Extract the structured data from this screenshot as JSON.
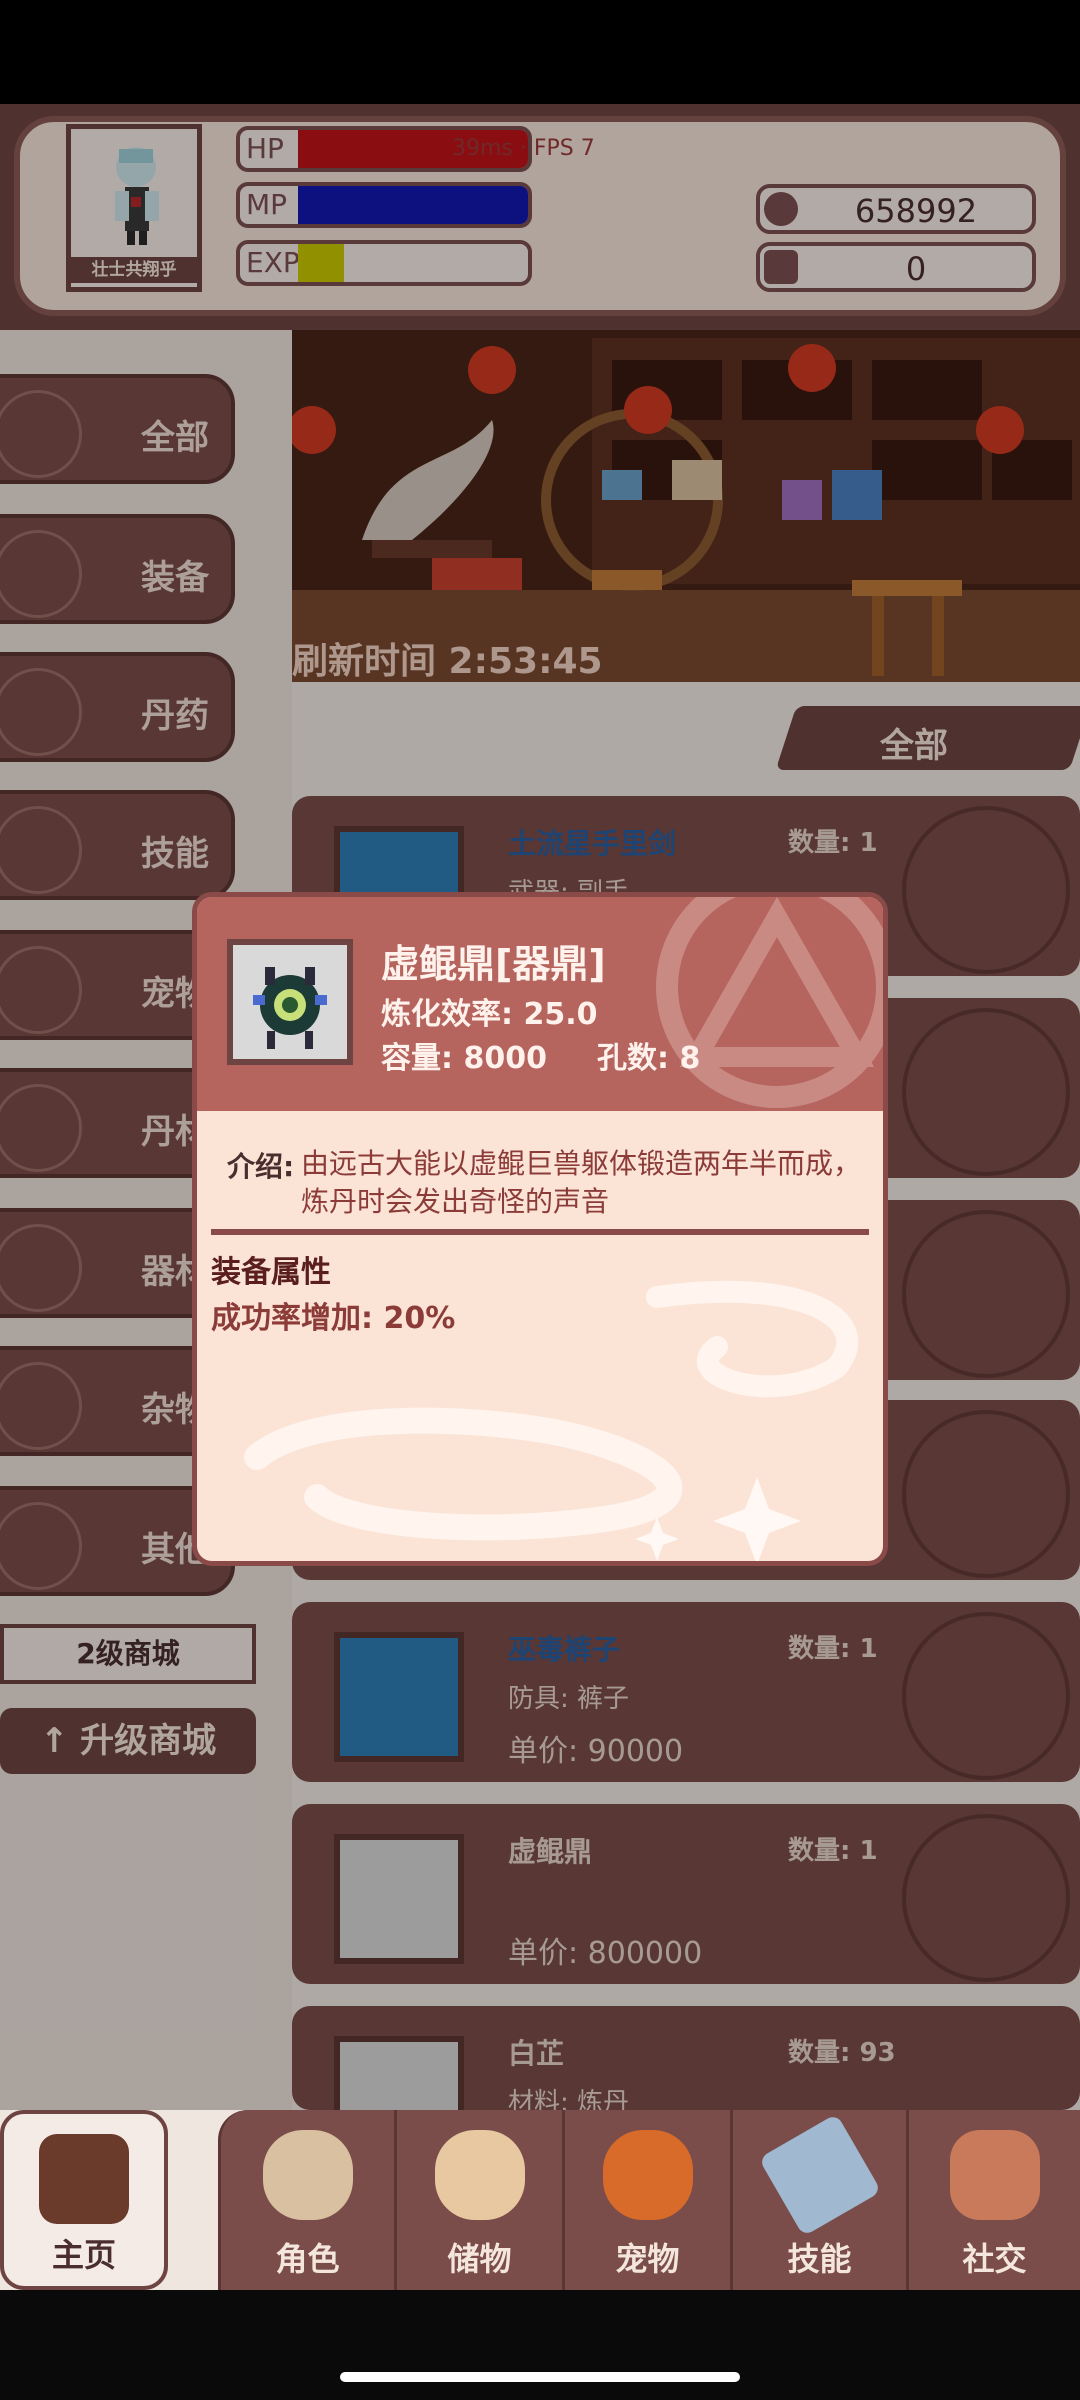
{
  "player": {
    "name": "壮士共翔乎",
    "hp_label": "HP",
    "mp_label": "MP",
    "exp_label": "EXP",
    "hp_fill": 1.0,
    "mp_fill": 1.0,
    "exp_fill": 0.2
  },
  "network": {
    "text": "39ms · FPS 7"
  },
  "currency": {
    "coins": "658992",
    "gems": "0"
  },
  "sidebar": {
    "items": [
      {
        "label": "全部"
      },
      {
        "label": "装备"
      },
      {
        "label": "丹药"
      },
      {
        "label": "技能"
      },
      {
        "label": "宠物"
      },
      {
        "label": "丹材"
      },
      {
        "label": "器材"
      },
      {
        "label": "杂物"
      },
      {
        "label": "其他"
      }
    ],
    "shop_level": "2级商城",
    "upgrade_label": "↑ 升级商城"
  },
  "shop": {
    "refresh_text": "刷新时间 2:53:45",
    "filter_label": "全部",
    "items": [
      {
        "name": "土流星手里剑",
        "qty": "数量: 1",
        "type": "武器: 副手",
        "price": ""
      },
      {
        "name": "巫毒裤子",
        "qty": "数量: 1",
        "type": "防具: 裤子",
        "price": "单价: 90000"
      },
      {
        "name": "虚鲲鼎",
        "qty": "数量: 1",
        "type": "",
        "price": "单价: 800000"
      },
      {
        "name": "白芷",
        "qty": "数量: 93",
        "type": "材料: 炼丹",
        "price": ""
      }
    ]
  },
  "dialog": {
    "title": "虚鲲鼎[器鼎]",
    "efficiency": "炼化效率: 25.0",
    "capacity": "容量: 8000",
    "holes": "孔数: 8",
    "intro_label": "介绍:",
    "intro_text": "由远古大能以虚鲲巨兽躯体锻造两年半而成，炼丹时会发出奇怪的声音",
    "attr_title": "装备属性",
    "attr_text": "成功率增加: 20%"
  },
  "bottomnav": {
    "items": [
      {
        "label": "主页",
        "icon": "pagoda-icon"
      },
      {
        "label": "角色",
        "icon": "character-icon"
      },
      {
        "label": "储物",
        "icon": "bag-icon"
      },
      {
        "label": "宠物",
        "icon": "fox-icon"
      },
      {
        "label": "技能",
        "icon": "sword-icon"
      },
      {
        "label": "社交",
        "icon": "handshake-icon"
      }
    ]
  },
  "colors": {
    "hp": "#c0121a",
    "mp": "#1218b0",
    "exp": "#c8c800",
    "accent": "#7a4d4a"
  }
}
